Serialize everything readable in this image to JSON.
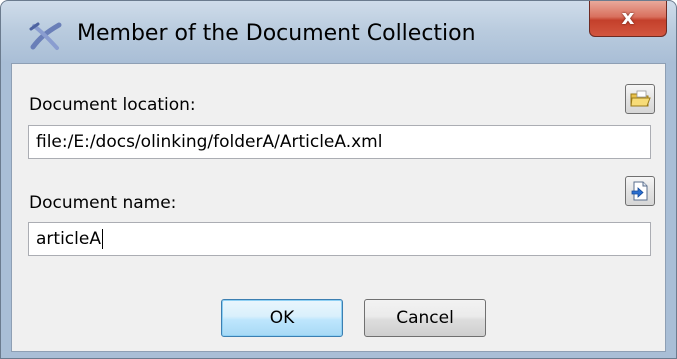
{
  "window": {
    "title": "Member of the Document Collection",
    "close_label": "x",
    "icon": "oxygen-x-icon"
  },
  "location": {
    "label": "Document location:",
    "value": "file:/E:/docs/olinking/folderA/ArticleA.xml",
    "browse_icon": "folder-icon"
  },
  "name": {
    "label": "Document name:",
    "value": "articleA",
    "insert_icon": "insert-document-icon"
  },
  "buttons": {
    "ok": "OK",
    "cancel": "Cancel"
  },
  "colors": {
    "titlebar": "#b9cbde",
    "close_button": "#c4402b",
    "panel": "#f0f0f0",
    "default_button": "#bee6fd"
  }
}
